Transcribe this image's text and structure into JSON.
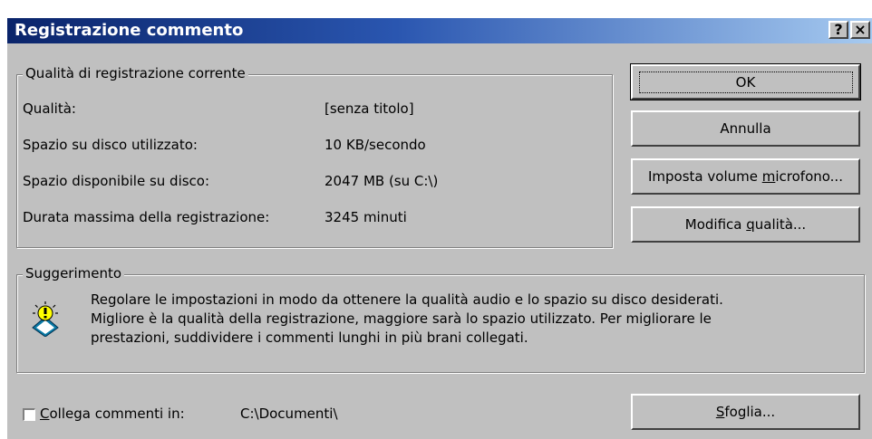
{
  "window": {
    "title": "Registrazione commento",
    "help_button": "?",
    "close_button": "×"
  },
  "quality_group": {
    "legend": "Qualità di registrazione corrente",
    "rows": [
      {
        "label": "Qualità:",
        "value": "[senza titolo]"
      },
      {
        "label": "Spazio su disco utilizzato:",
        "value": "10 KB/secondo"
      },
      {
        "label": "Spazio disponibile su disco:",
        "value": "2047 MB (su C:\\)"
      },
      {
        "label": "Durata massima della registrazione:",
        "value": "3245 minuti"
      }
    ]
  },
  "buttons": {
    "ok": "OK",
    "cancel": "Annulla",
    "mic_pre": "Imposta volume ",
    "mic_u": "m",
    "mic_post": "icrofono...",
    "quality_pre": "Modifica ",
    "quality_u": "q",
    "quality_post": "ualità...",
    "browse_u": "S",
    "browse_post": "foglia..."
  },
  "tip_group": {
    "legend": "Suggerimento",
    "icon": "lightbulb-icon",
    "lines": [
      "Regolare le impostazioni in modo da ottenere la qualità audio e lo spazio su disco desiderati.",
      "Migliore è la qualità della registrazione, maggiore sarà lo spazio utilizzato. Per migliorare le",
      "prestazioni, suddividere i commenti lunghi in più brani collegati."
    ]
  },
  "link": {
    "checked": false,
    "label_u": "C",
    "label_post": "ollega commenti in:",
    "path": "C:\\Documenti\\"
  }
}
